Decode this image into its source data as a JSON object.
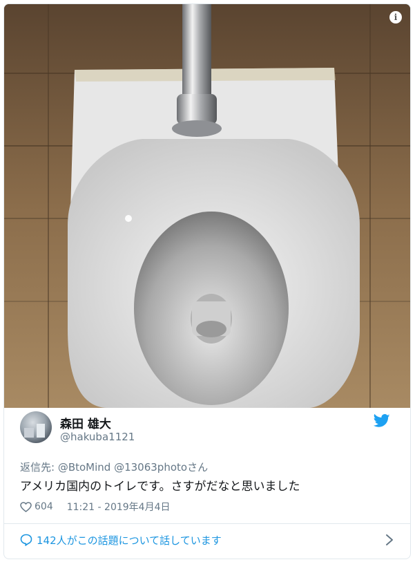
{
  "tweet": {
    "author_name": "森田 雄大",
    "author_handle": "@hakuba1121",
    "reply_prefix": "返信先: ",
    "reply_mentions": "@BtoMind @13063photo",
    "reply_suffix": "さん",
    "text": "アメリカ国内のトイレです。さすがだなと思いました",
    "like_count": "604",
    "timestamp": "11:21 - 2019年4月4日",
    "conversation_link": "142人がこの話題について話しています"
  },
  "icons": {
    "info": "info-icon",
    "twitter": "twitter-bird-icon",
    "like": "heart-icon",
    "reply": "speech-bubble-icon",
    "chevron": "chevron-right-icon"
  },
  "colors": {
    "link": "#1b95e0",
    "muted": "#657786",
    "text": "#14171a",
    "twitter_blue": "#1da1f2"
  }
}
